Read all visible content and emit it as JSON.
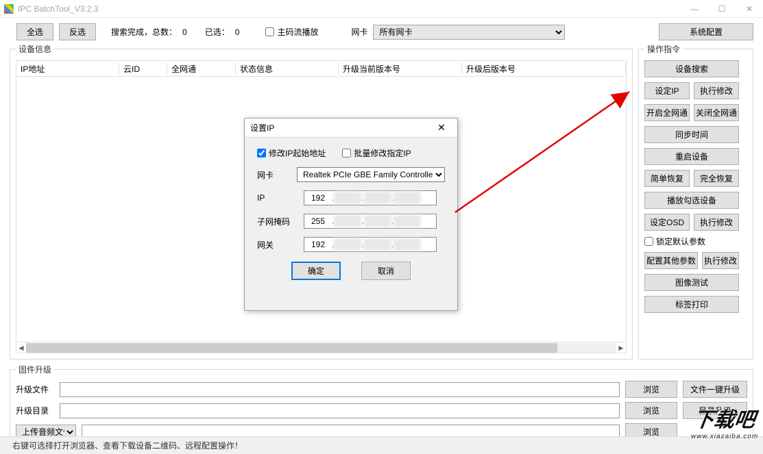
{
  "window": {
    "title": "IPC BatchTool_V3.2.3",
    "minimize": "—",
    "maximize": "☐",
    "close": "✕"
  },
  "toolbar": {
    "select_all": "全选",
    "invert": "反选",
    "search_done": "搜索完成，总数：",
    "total": "0",
    "selected_label": "已选：",
    "selected": "0",
    "mainstream_play": "主码流播放",
    "nic_label": "网卡",
    "nic_value": "所有网卡",
    "system_config": "系统配置"
  },
  "device_info": {
    "legend": "设备信息",
    "cols": [
      "IP地址",
      "云ID",
      "全网通",
      "状态信息",
      "升级当前版本号",
      "升级后版本号"
    ]
  },
  "ops": {
    "legend": "操作指令",
    "search": "设备搜索",
    "set_ip": "设定IP",
    "exec_modify": "执行修改",
    "open_all": "开启全网通",
    "close_all": "关闭全网通",
    "sync_time": "同步时间",
    "reboot": "重启设备",
    "simple_restore": "简单恢复",
    "full_restore": "完全恢复",
    "play_checked": "播放勾选设备",
    "set_osd": "设定OSD",
    "exec_modify2": "执行修改",
    "lock_default": "锁定默认参数",
    "other_params": "配置其他参数",
    "exec_modify3": "执行修改",
    "image_test": "图像测试",
    "label_print": "标签打印"
  },
  "firmware": {
    "legend": "固件升级",
    "file_label": "升级文件",
    "dir_label": "升级目录",
    "browse": "浏览",
    "one_key": "文件一键升级",
    "dir_upgrade": "目录升级",
    "upload_audio": "上传音频文件"
  },
  "status": "右键可选择打开浏览器、查看下载设备二维码、远程配置操作！",
  "dialog": {
    "title": "设置IP",
    "modify_start": "修改IP起始地址",
    "batch_modify": "批量修改指定IP",
    "nic_label": "网卡",
    "nic_value": "Realtek PCIe GBE Family Controlle",
    "ip_label": "IP",
    "ip1": "192",
    "mask_label": "子网掩码",
    "mask1": "255",
    "gw_label": "网关",
    "gw1": "192",
    "ok": "确定",
    "cancel": "取消"
  },
  "watermark": {
    "big": "下载吧",
    "small": "www.xiazaiba.com"
  }
}
